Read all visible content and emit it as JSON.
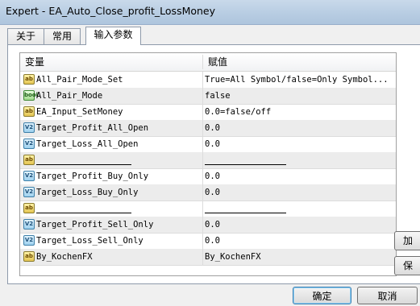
{
  "window": {
    "title": "Expert - EA_Auto_Close_profit_LossMoney"
  },
  "tabs": [
    {
      "label": "关于"
    },
    {
      "label": "常用"
    },
    {
      "label": "输入参数"
    }
  ],
  "grid": {
    "header": {
      "variable": "变量",
      "value": "赋值"
    },
    "rows": [
      {
        "icon": "ab",
        "name": "All_Pair_Mode_Set",
        "value": "True=All Symbol/false=Only Symbol..."
      },
      {
        "icon": "bool",
        "name": "All_Pair_Mode",
        "value": "false"
      },
      {
        "icon": "ab",
        "name": "EA_Input_SetMoney",
        "value": "0.0=false/off"
      },
      {
        "icon": "v2",
        "name": "Target_Profit_All_Open",
        "value": "0.0"
      },
      {
        "icon": "v2",
        "name": "Target_Loss_All_Open",
        "value": "0.0"
      },
      {
        "icon": "ab",
        "name": "",
        "value": ""
      },
      {
        "icon": "v2",
        "name": "Target_Profit_Buy_Only",
        "value": "0.0"
      },
      {
        "icon": "v2",
        "name": "Target_Loss_Buy_Only",
        "value": "0.0"
      },
      {
        "icon": "ab",
        "name": "",
        "value": ""
      },
      {
        "icon": "v2",
        "name": "Target_Profit_Sell_Only",
        "value": "0.0"
      },
      {
        "icon": "v2",
        "name": "Target_Loss_Sell_Only",
        "value": "0.0"
      },
      {
        "icon": "ab",
        "name": "By_KochenFX",
        "value": "By_KochenFX"
      }
    ]
  },
  "side_buttons": [
    {
      "label": "加"
    },
    {
      "label": "保"
    }
  ],
  "buttons": {
    "ok": "确定",
    "cancel": "取消"
  },
  "icons": {
    "ab": "ab",
    "v2": "V2",
    "bool": "bool"
  }
}
